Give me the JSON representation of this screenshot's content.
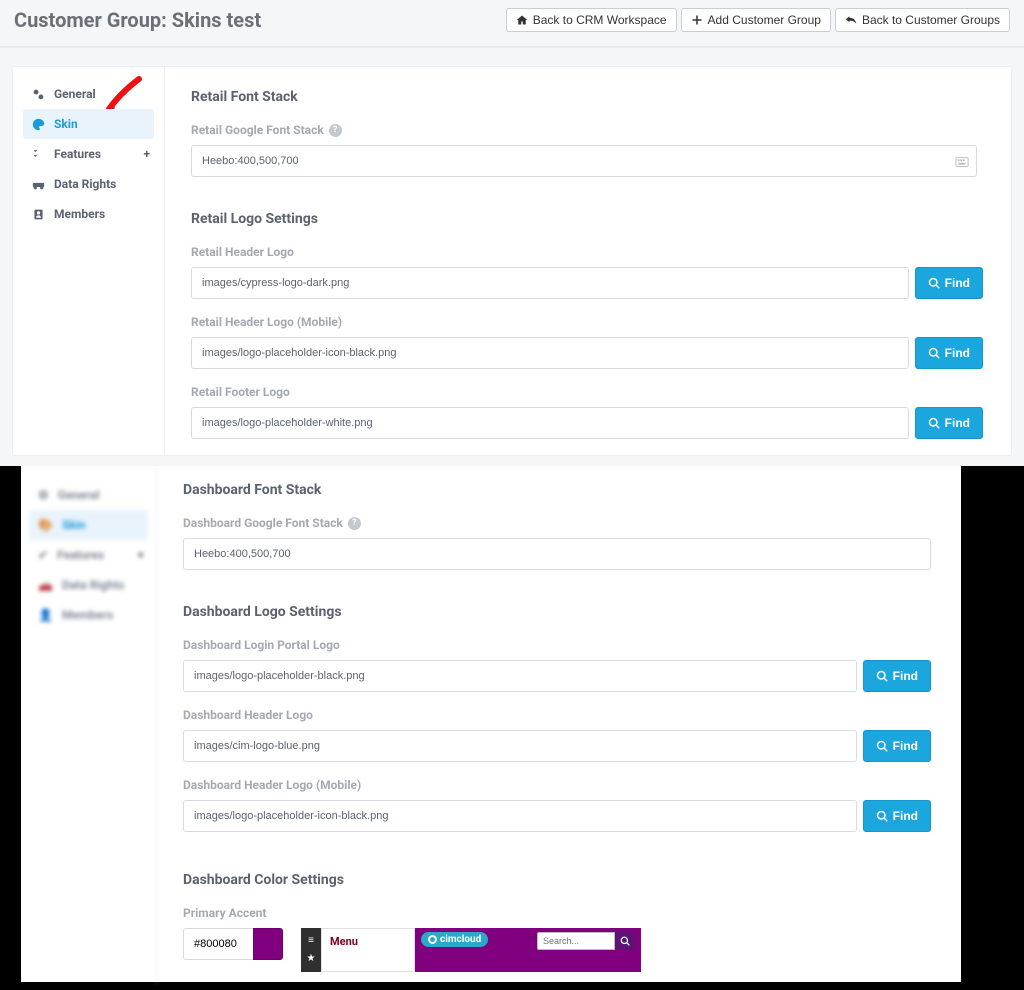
{
  "header": {
    "title": "Customer Group: Skins test",
    "buttons": {
      "back_workspace": "Back to CRM Workspace",
      "add_group": "Add Customer Group",
      "back_groups": "Back to Customer Groups"
    }
  },
  "sidebar": {
    "items": [
      {
        "label": "General"
      },
      {
        "label": "Skin"
      },
      {
        "label": "Features"
      },
      {
        "label": "Data Rights"
      },
      {
        "label": "Members"
      }
    ]
  },
  "retail": {
    "font_section_title": "Retail Font Stack",
    "google_font_label": "Retail Google Font Stack",
    "google_font_value": "Heebo:400,500,700",
    "logo_section_title": "Retail Logo Settings",
    "header_logo_label": "Retail Header Logo",
    "header_logo_value": "images/cypress-logo-dark.png",
    "header_logo_mobile_label": "Retail Header Logo (Mobile)",
    "header_logo_mobile_value": "images/logo-placeholder-icon-black.png",
    "footer_logo_label": "Retail Footer Logo",
    "footer_logo_value": "images/logo-placeholder-white.png"
  },
  "find_label": "Find",
  "dashboard": {
    "font_section_title": "Dashboard Font Stack",
    "google_font_label": "Dashboard Google Font Stack",
    "google_font_value": "Heebo:400,500,700",
    "logo_section_title": "Dashboard Logo Settings",
    "login_logo_label": "Dashboard Login Portal Logo",
    "login_logo_value": "images/logo-placeholder-black.png",
    "header_logo_label": "Dashboard Header Logo",
    "header_logo_value": "images/cim-logo-blue.png",
    "header_logo_mobile_label": "Dashboard Header Logo (Mobile)",
    "header_logo_mobile_value": "images/logo-placeholder-icon-black.png",
    "color_section_title": "Dashboard Color Settings",
    "primary_accent_label": "Primary Accent",
    "primary_accent_value": "#800080"
  },
  "preview": {
    "menu_label": "Menu",
    "brand": "cimcloud",
    "search_placeholder": "Search..."
  }
}
